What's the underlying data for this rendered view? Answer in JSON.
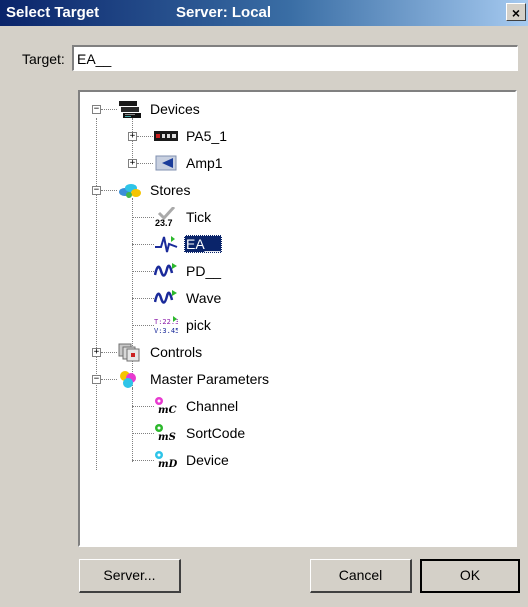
{
  "window": {
    "title": "Select Target",
    "server_label": "Server: Local",
    "close_glyph": "×"
  },
  "target": {
    "label": "Target:",
    "value": "EA__"
  },
  "tree": {
    "devices": {
      "label": "Devices",
      "expander": "−",
      "children": [
        {
          "label": "PA5_1",
          "expander": "+"
        },
        {
          "label": "Amp1",
          "expander": "+"
        }
      ]
    },
    "stores": {
      "label": "Stores",
      "expander": "−",
      "children": [
        {
          "label": "Tick",
          "icon_text": "23.7"
        },
        {
          "label": "EA__",
          "selected": true
        },
        {
          "label": "PD__"
        },
        {
          "label": "Wave"
        },
        {
          "label": "pick",
          "icon_text_1": "T:22.3",
          "icon_text_2": "V:3.45"
        }
      ]
    },
    "controls": {
      "label": "Controls",
      "expander": "+"
    },
    "master": {
      "label": "Master Parameters",
      "expander": "−",
      "children": [
        {
          "label": "Channel",
          "icon_text": "mC"
        },
        {
          "label": "SortCode",
          "icon_text": "mS"
        },
        {
          "label": "Device",
          "icon_text": "mD"
        }
      ]
    }
  },
  "buttons": {
    "server": "Server...",
    "cancel": "Cancel",
    "ok": "OK"
  },
  "colors": {
    "title_start": "#0a246a",
    "title_end": "#a6caf0",
    "dialog_face": "#d4d0c8",
    "selection": "#0a246a"
  },
  "icons": {
    "devices": "rack-devices-icon",
    "pa5": "attenuator-device-icon",
    "amp": "amplifier-icon",
    "stores": "stores-icon",
    "tick": "checkmark-value-icon",
    "ea": "spike-waveform-icon",
    "pd": "wave-arrow-icon",
    "wave": "wave-arrow-icon",
    "pick": "timestamp-value-icon",
    "controls": "controls-icon",
    "master": "master-parameters-icon",
    "param": "parameter-icon"
  }
}
